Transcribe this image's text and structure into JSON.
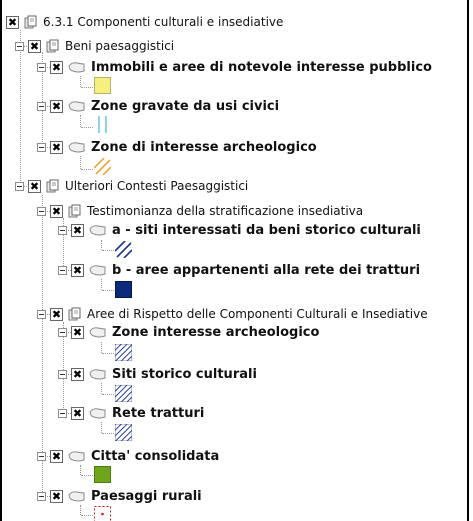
{
  "tree": {
    "root": {
      "label": "6.3.1 Componenti culturali e insediative",
      "checked": "✖"
    },
    "beni_paesaggistici": {
      "label": "Beni paesaggistici",
      "layers": {
        "immobili": "Immobili e aree di notevole interesse pubblico",
        "zone_usi_civici": "Zone gravate da usi civici",
        "zone_archeologico": "Zone di interesse archeologico"
      }
    },
    "ulteriori": {
      "label": "Ulteriori Contesti Paesaggistici",
      "testimonianza": {
        "label": "Testimonianza della stratificazione insediativa",
        "layers": {
          "siti": "a - siti interessati da beni storico culturali",
          "tratturi": "b - aree appartenenti alla rete dei tratturi"
        }
      },
      "aree_rispetto": {
        "label": "Aree di Rispetto delle Componenti Culturali e Insediative",
        "layers": {
          "zone": "Zone interesse archeologico",
          "siti": "Siti storico culturali",
          "rete": "Rete tratturi"
        }
      },
      "layers": {
        "citta": "Citta' consolidata",
        "paesaggi": "Paesaggi rurali"
      }
    }
  },
  "colors": {
    "yellow_fill": "#f5f07e",
    "usi_civici_stripes": "#8fd1f0",
    "archeologico_hatch": "#e8a93a",
    "navy": "#0b2a7a",
    "green": "#6fa51a",
    "red_dot": "#d01515"
  },
  "icons": {
    "checkbox": "cross-check-icon",
    "group": "group-icon",
    "layer": "polygon-layer-icon",
    "expander": "collapse-minus-icon"
  }
}
